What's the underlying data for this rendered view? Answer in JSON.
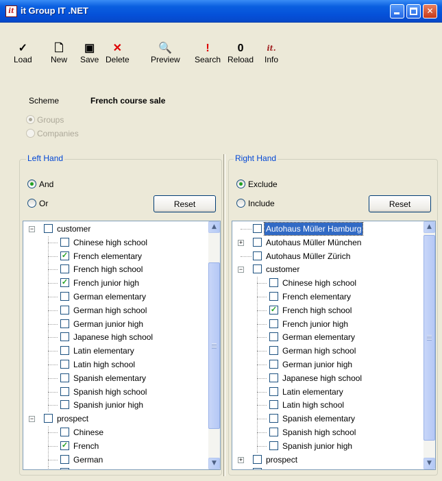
{
  "window": {
    "title": "it Group IT .NET",
    "icon_text": "it",
    "accent": "#0550d8"
  },
  "toolbar": [
    {
      "label": "Load",
      "icon": "checkmark-icon",
      "glyph": "✓"
    },
    {
      "label": "New",
      "icon": "new-document-icon",
      "glyph": "🗋"
    },
    {
      "label": "Save",
      "icon": "floppy-disk-icon",
      "glyph": "▣"
    },
    {
      "label": "Delete",
      "icon": "delete-x-icon",
      "glyph": "✕"
    },
    {
      "label": "Preview",
      "icon": "preview-magnifier-icon",
      "glyph": "🔍"
    },
    {
      "label": "Search",
      "icon": "exclamation-icon",
      "glyph": "!"
    },
    {
      "label": "Reload",
      "icon": "paperclip-icon",
      "glyph": "0"
    },
    {
      "label": "Info",
      "icon": "info-logo-icon",
      "glyph": "it."
    }
  ],
  "scheme": {
    "label": "Scheme",
    "value": "French course sale",
    "options": [
      {
        "label": "Groups",
        "checked": true
      },
      {
        "label": "Companies",
        "checked": false
      }
    ]
  },
  "left": {
    "title": "Left Hand",
    "radio_and": "And",
    "radio_or": "Or",
    "selected": "And",
    "reset_label": "Reset",
    "tree": [
      {
        "label": "customer",
        "level": 0,
        "checked": false,
        "expander": "−"
      },
      {
        "label": "Chinese high school",
        "level": 1,
        "checked": false
      },
      {
        "label": "French elementary",
        "level": 1,
        "checked": true
      },
      {
        "label": "French high school",
        "level": 1,
        "checked": false
      },
      {
        "label": "French junior high",
        "level": 1,
        "checked": true
      },
      {
        "label": "German elementary",
        "level": 1,
        "checked": false
      },
      {
        "label": "German high school",
        "level": 1,
        "checked": false
      },
      {
        "label": "German junior high",
        "level": 1,
        "checked": false
      },
      {
        "label": "Japanese high school",
        "level": 1,
        "checked": false
      },
      {
        "label": "Latin elementary",
        "level": 1,
        "checked": false
      },
      {
        "label": "Latin high school",
        "level": 1,
        "checked": false
      },
      {
        "label": "Spanish elementary",
        "level": 1,
        "checked": false
      },
      {
        "label": "Spanish high school",
        "level": 1,
        "checked": false
      },
      {
        "label": "Spanish junior high",
        "level": 1,
        "checked": false
      },
      {
        "label": "prospect",
        "level": 0,
        "checked": false,
        "expander": "−"
      },
      {
        "label": "Chinese",
        "level": 1,
        "checked": false
      },
      {
        "label": "French",
        "level": 1,
        "checked": true
      },
      {
        "label": "German",
        "level": 1,
        "checked": false
      },
      {
        "label": "",
        "level": 1,
        "checked": false
      }
    ]
  },
  "right": {
    "title": "Right Hand",
    "radio_exclude": "Exclude",
    "radio_include": "Include",
    "selected": "Exclude",
    "reset_label": "Reset",
    "tree": [
      {
        "label": "Autohaus Müller Hamburg",
        "level": 0,
        "checked": false,
        "selected": true
      },
      {
        "label": "Autohaus Müller München",
        "level": 0,
        "checked": false,
        "expander": "+"
      },
      {
        "label": "Autohaus Müller Zürich",
        "level": 0,
        "checked": false
      },
      {
        "label": "customer",
        "level": 0,
        "checked": false,
        "expander": "−"
      },
      {
        "label": "Chinese high school",
        "level": 1,
        "checked": false
      },
      {
        "label": "French elementary",
        "level": 1,
        "checked": false
      },
      {
        "label": "French high school",
        "level": 1,
        "checked": true
      },
      {
        "label": "French junior high",
        "level": 1,
        "checked": false
      },
      {
        "label": "German elementary",
        "level": 1,
        "checked": false
      },
      {
        "label": "German high school",
        "level": 1,
        "checked": false
      },
      {
        "label": "German junior high",
        "level": 1,
        "checked": false
      },
      {
        "label": "Japanese high school",
        "level": 1,
        "checked": false
      },
      {
        "label": "Latin elementary",
        "level": 1,
        "checked": false
      },
      {
        "label": "Latin high school",
        "level": 1,
        "checked": false
      },
      {
        "label": "Spanish elementary",
        "level": 1,
        "checked": false
      },
      {
        "label": "Spanish high school",
        "level": 1,
        "checked": false
      },
      {
        "label": "Spanish junior high",
        "level": 1,
        "checked": false
      },
      {
        "label": "prospect",
        "level": 0,
        "checked": false,
        "expander": "+"
      },
      {
        "label": "",
        "level": 0,
        "checked": false
      }
    ]
  }
}
